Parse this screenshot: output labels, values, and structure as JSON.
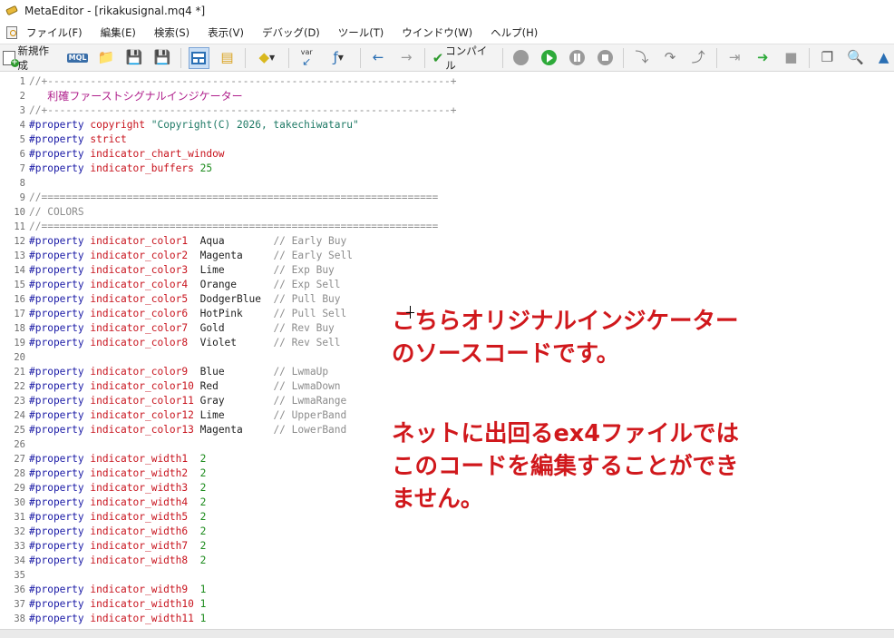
{
  "window": {
    "title": "MetaEditor - [rikakusignal.mq4 *]"
  },
  "menu": {
    "items": [
      "ファイル(F)",
      "編集(E)",
      "検索(S)",
      "表示(V)",
      "デバッグ(D)",
      "ツール(T)",
      "ウインドウ(W)",
      "ヘルプ(H)"
    ]
  },
  "toolbar": {
    "new_label": "新規作成",
    "compile_label": "コンパイル",
    "var_label": "var",
    "mql_label": "MQL"
  },
  "editor": {
    "lines": [
      {
        "n": "1",
        "parts": [
          {
            "c": "cmt",
            "t": "//+------------------------------------------------------------------+"
          }
        ]
      },
      {
        "n": "2",
        "parts": [
          {
            "c": "cmt",
            "t": "   "
          },
          {
            "c": "jp",
            "t": "利確ファーストシグナルインジケーター"
          }
        ]
      },
      {
        "n": "3",
        "parts": [
          {
            "c": "cmt",
            "t": "//+------------------------------------------------------------------+"
          }
        ]
      },
      {
        "n": "4",
        "parts": [
          {
            "c": "kw",
            "t": "#property "
          },
          {
            "c": "nm",
            "t": "copyright "
          },
          {
            "c": "str",
            "t": "\"Copyright(C) 2026, takechiwataru\""
          }
        ]
      },
      {
        "n": "5",
        "parts": [
          {
            "c": "kw",
            "t": "#property "
          },
          {
            "c": "nm",
            "t": "strict"
          }
        ]
      },
      {
        "n": "6",
        "parts": [
          {
            "c": "kw",
            "t": "#property "
          },
          {
            "c": "nm",
            "t": "indicator_chart_window"
          }
        ]
      },
      {
        "n": "7",
        "parts": [
          {
            "c": "kw",
            "t": "#property "
          },
          {
            "c": "nm",
            "t": "indicator_buffers "
          },
          {
            "c": "num",
            "t": "25"
          }
        ]
      },
      {
        "n": "8",
        "parts": []
      },
      {
        "n": "9",
        "parts": [
          {
            "c": "cmt",
            "t": "//================================================================="
          }
        ]
      },
      {
        "n": "10",
        "parts": [
          {
            "c": "cmt",
            "t": "// COLORS"
          }
        ]
      },
      {
        "n": "11",
        "parts": [
          {
            "c": "cmt",
            "t": "//================================================================="
          }
        ]
      },
      {
        "n": "12",
        "parts": [
          {
            "c": "kw",
            "t": "#property "
          },
          {
            "c": "nm",
            "t": "indicator_color1  "
          },
          {
            "c": "plain",
            "t": "Aqua        "
          },
          {
            "c": "cmt",
            "t": "// Early Buy"
          }
        ]
      },
      {
        "n": "13",
        "parts": [
          {
            "c": "kw",
            "t": "#property "
          },
          {
            "c": "nm",
            "t": "indicator_color2  "
          },
          {
            "c": "plain",
            "t": "Magenta     "
          },
          {
            "c": "cmt",
            "t": "// Early Sell"
          }
        ]
      },
      {
        "n": "14",
        "parts": [
          {
            "c": "kw",
            "t": "#property "
          },
          {
            "c": "nm",
            "t": "indicator_color3  "
          },
          {
            "c": "plain",
            "t": "Lime        "
          },
          {
            "c": "cmt",
            "t": "// Exp Buy"
          }
        ]
      },
      {
        "n": "15",
        "parts": [
          {
            "c": "kw",
            "t": "#property "
          },
          {
            "c": "nm",
            "t": "indicator_color4  "
          },
          {
            "c": "plain",
            "t": "Orange      "
          },
          {
            "c": "cmt",
            "t": "// Exp Sell"
          }
        ]
      },
      {
        "n": "16",
        "parts": [
          {
            "c": "kw",
            "t": "#property "
          },
          {
            "c": "nm",
            "t": "indicator_color5  "
          },
          {
            "c": "plain",
            "t": "DodgerBlue  "
          },
          {
            "c": "cmt",
            "t": "// Pull Buy"
          }
        ]
      },
      {
        "n": "17",
        "parts": [
          {
            "c": "kw",
            "t": "#property "
          },
          {
            "c": "nm",
            "t": "indicator_color6  "
          },
          {
            "c": "plain",
            "t": "HotPink     "
          },
          {
            "c": "cmt",
            "t": "// Pull Sell"
          }
        ]
      },
      {
        "n": "18",
        "parts": [
          {
            "c": "kw",
            "t": "#property "
          },
          {
            "c": "nm",
            "t": "indicator_color7  "
          },
          {
            "c": "plain",
            "t": "Gold        "
          },
          {
            "c": "cmt",
            "t": "// Rev Buy"
          }
        ]
      },
      {
        "n": "19",
        "parts": [
          {
            "c": "kw",
            "t": "#property "
          },
          {
            "c": "nm",
            "t": "indicator_color8  "
          },
          {
            "c": "plain",
            "t": "Violet      "
          },
          {
            "c": "cmt",
            "t": "// Rev Sell"
          }
        ]
      },
      {
        "n": "20",
        "parts": []
      },
      {
        "n": "21",
        "parts": [
          {
            "c": "kw",
            "t": "#property "
          },
          {
            "c": "nm",
            "t": "indicator_color9  "
          },
          {
            "c": "plain",
            "t": "Blue        "
          },
          {
            "c": "cmt",
            "t": "// LwmaUp"
          }
        ]
      },
      {
        "n": "22",
        "parts": [
          {
            "c": "kw",
            "t": "#property "
          },
          {
            "c": "nm",
            "t": "indicator_color10 "
          },
          {
            "c": "plain",
            "t": "Red         "
          },
          {
            "c": "cmt",
            "t": "// LwmaDown"
          }
        ]
      },
      {
        "n": "23",
        "parts": [
          {
            "c": "kw",
            "t": "#property "
          },
          {
            "c": "nm",
            "t": "indicator_color11 "
          },
          {
            "c": "plain",
            "t": "Gray        "
          },
          {
            "c": "cmt",
            "t": "// LwmaRange"
          }
        ]
      },
      {
        "n": "24",
        "parts": [
          {
            "c": "kw",
            "t": "#property "
          },
          {
            "c": "nm",
            "t": "indicator_color12 "
          },
          {
            "c": "plain",
            "t": "Lime        "
          },
          {
            "c": "cmt",
            "t": "// UpperBand"
          }
        ]
      },
      {
        "n": "25",
        "parts": [
          {
            "c": "kw",
            "t": "#property "
          },
          {
            "c": "nm",
            "t": "indicator_color13 "
          },
          {
            "c": "plain",
            "t": "Magenta     "
          },
          {
            "c": "cmt",
            "t": "// LowerBand"
          }
        ]
      },
      {
        "n": "26",
        "parts": []
      },
      {
        "n": "27",
        "parts": [
          {
            "c": "kw",
            "t": "#property "
          },
          {
            "c": "nm",
            "t": "indicator_width1  "
          },
          {
            "c": "num",
            "t": "2"
          }
        ]
      },
      {
        "n": "28",
        "parts": [
          {
            "c": "kw",
            "t": "#property "
          },
          {
            "c": "nm",
            "t": "indicator_width2  "
          },
          {
            "c": "num",
            "t": "2"
          }
        ]
      },
      {
        "n": "29",
        "parts": [
          {
            "c": "kw",
            "t": "#property "
          },
          {
            "c": "nm",
            "t": "indicator_width3  "
          },
          {
            "c": "num",
            "t": "2"
          }
        ]
      },
      {
        "n": "30",
        "parts": [
          {
            "c": "kw",
            "t": "#property "
          },
          {
            "c": "nm",
            "t": "indicator_width4  "
          },
          {
            "c": "num",
            "t": "2"
          }
        ]
      },
      {
        "n": "31",
        "parts": [
          {
            "c": "kw",
            "t": "#property "
          },
          {
            "c": "nm",
            "t": "indicator_width5  "
          },
          {
            "c": "num",
            "t": "2"
          }
        ]
      },
      {
        "n": "32",
        "parts": [
          {
            "c": "kw",
            "t": "#property "
          },
          {
            "c": "nm",
            "t": "indicator_width6  "
          },
          {
            "c": "num",
            "t": "2"
          }
        ]
      },
      {
        "n": "33",
        "parts": [
          {
            "c": "kw",
            "t": "#property "
          },
          {
            "c": "nm",
            "t": "indicator_width7  "
          },
          {
            "c": "num",
            "t": "2"
          }
        ]
      },
      {
        "n": "34",
        "parts": [
          {
            "c": "kw",
            "t": "#property "
          },
          {
            "c": "nm",
            "t": "indicator_width8  "
          },
          {
            "c": "num",
            "t": "2"
          }
        ]
      },
      {
        "n": "35",
        "parts": []
      },
      {
        "n": "36",
        "parts": [
          {
            "c": "kw",
            "t": "#property "
          },
          {
            "c": "nm",
            "t": "indicator_width9  "
          },
          {
            "c": "num",
            "t": "1"
          }
        ]
      },
      {
        "n": "37",
        "parts": [
          {
            "c": "kw",
            "t": "#property "
          },
          {
            "c": "nm",
            "t": "indicator_width10 "
          },
          {
            "c": "num",
            "t": "1"
          }
        ]
      },
      {
        "n": "38",
        "parts": [
          {
            "c": "kw",
            "t": "#property "
          },
          {
            "c": "nm",
            "t": "indicator_width11 "
          },
          {
            "c": "num",
            "t": "1"
          }
        ]
      }
    ]
  },
  "annotations": {
    "block1": [
      "こちらオリジナルインジケーター",
      "のソースコードです。"
    ],
    "block2": [
      "ネットに出回るex4ファイルでは",
      "このコードを編集することができ",
      "ません。"
    ]
  },
  "colors": {
    "annotation": "#d0181c",
    "keyword": "#1a1aa6",
    "property_name": "#c8141e",
    "string": "#1f7a66",
    "comment": "#8c8c8c",
    "number": "#1e8c1e"
  }
}
